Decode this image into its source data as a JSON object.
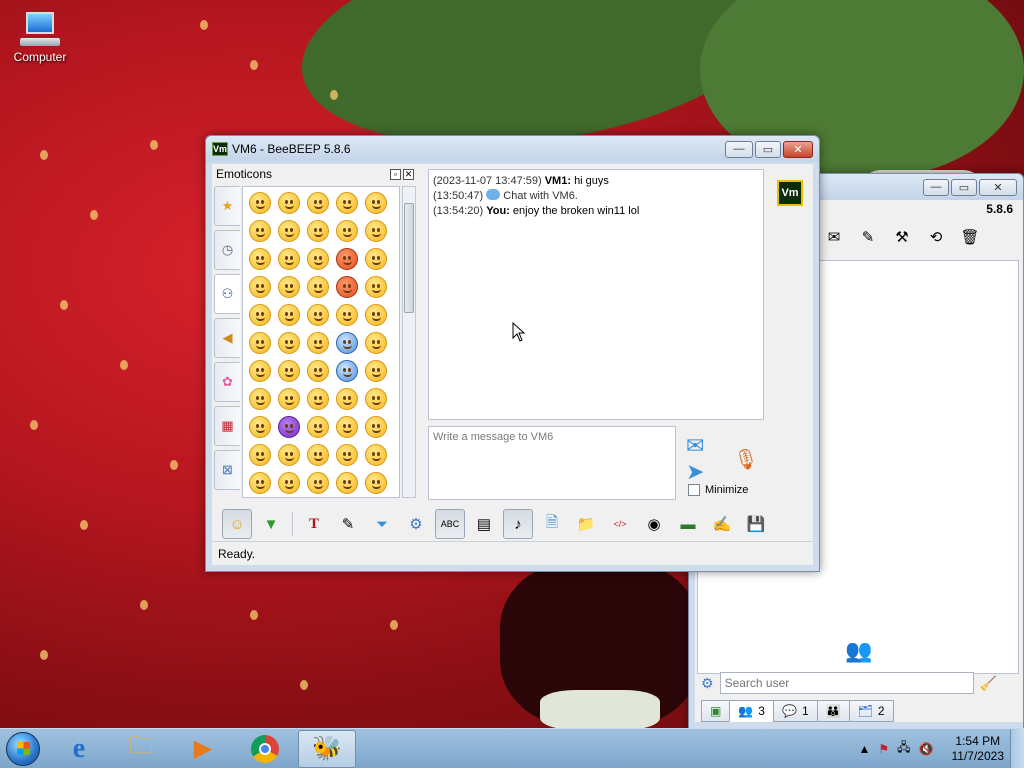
{
  "desktop": {
    "icons": [
      {
        "label": "Computer",
        "icon": "computer-icon"
      }
    ]
  },
  "main_window": {
    "title": "VM6 - BeeBEEP 5.8.6",
    "badge": "Vm",
    "emoticons_panel": {
      "title": "Emoticons",
      "categories": [
        "star-icon",
        "clock-icon",
        "people-icon",
        "bell-icon",
        "flower-icon",
        "building-icon",
        "symbols-icon"
      ]
    },
    "chat": {
      "messages": [
        {
          "timestamp": "(2023-11-07 13:47:59)",
          "sender": "VM1:",
          "text": "hi guys"
        },
        {
          "timestamp": "(13:50:47)",
          "sender": "",
          "text": "Chat with VM6."
        },
        {
          "timestamp": "(13:54:20)",
          "sender": "You:",
          "text": "enjoy the broken win11 lol"
        }
      ]
    },
    "avatar": "Vm",
    "input_placeholder": "Write a message to VM6",
    "minimize_label": "Minimize",
    "status": "Ready."
  },
  "back_window": {
    "version": "5.8.6",
    "search_placeholder": "Search user",
    "tabs": [
      {
        "icon": "network-icon",
        "label": ""
      },
      {
        "icon": "users-icon",
        "label": "3"
      },
      {
        "icon": "chat-icon",
        "label": "1"
      },
      {
        "icon": "group-icon",
        "label": ""
      },
      {
        "icon": "file-share-icon",
        "label": "2"
      }
    ]
  },
  "taskbar": {
    "clock_time": "1:54 PM",
    "clock_date": "11/7/2023"
  }
}
